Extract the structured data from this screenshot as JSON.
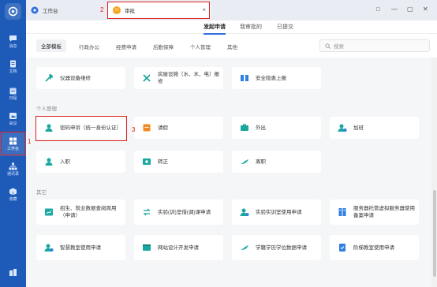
{
  "sidebar": {
    "items": [
      {
        "label": "消息"
      },
      {
        "label": "文档"
      },
      {
        "label": "日程"
      },
      {
        "label": "会议"
      },
      {
        "label": "工作台"
      },
      {
        "label": "通讯录"
      },
      {
        "label": "收藏"
      }
    ]
  },
  "tabs": {
    "home": "工作台",
    "current": "审批",
    "close": "×"
  },
  "window_controls": [
    "□",
    "—",
    "▢",
    "✕"
  ],
  "subtabs": [
    "发起申请",
    "我审批的",
    "已提交"
  ],
  "filters": [
    "全部模板",
    "行政办公",
    "经费申请",
    "后勤保障",
    "个人管理",
    "其他"
  ],
  "search": {
    "placeholder": "搜索"
  },
  "sections": {
    "top": [
      {
        "label": "仪器设备维修"
      },
      {
        "label": "房屋设施（水、木、电）报修"
      },
      {
        "label": "安全隐患上报"
      }
    ],
    "personal": {
      "title": "个人管理",
      "items": [
        {
          "label": "密码申诉（统一身份认证）"
        },
        {
          "label": "请假"
        },
        {
          "label": "外出"
        },
        {
          "label": "加班"
        },
        {
          "label": "入职"
        },
        {
          "label": "转正"
        },
        {
          "label": "离职"
        }
      ]
    },
    "other": {
      "title": "其它",
      "items": [
        {
          "label": "招生、就业数据查阅周用（申请）"
        },
        {
          "label": "实验(训)室借(调)课申请"
        },
        {
          "label": "实验实训室使用申请"
        },
        {
          "label": "服务器托管虚拟服务器使用备案申请"
        },
        {
          "label": "智慧教室使用申请"
        },
        {
          "label": "网站设计开发申请"
        },
        {
          "label": "学籍学历学位数据申请"
        },
        {
          "label": "阶梯教室使用申请"
        }
      ]
    }
  },
  "annotations": [
    "1",
    "2",
    "3"
  ],
  "colors": {
    "sidebar": "#1e5bb8",
    "accent": "#2f6fe0",
    "annotation": "#e02020",
    "icon_teal": "#19a8a0",
    "icon_blue": "#2f7fe0"
  }
}
